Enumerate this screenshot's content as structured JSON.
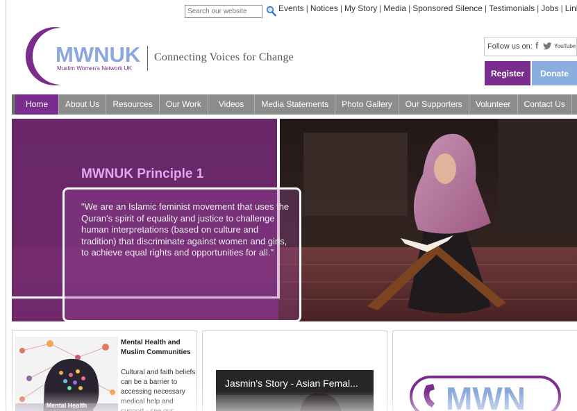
{
  "search": {
    "placeholder": "Search our website"
  },
  "top_links": [
    "Events",
    "Notices",
    "My Story",
    "Media",
    "Sponsored Silence",
    "Testimonials",
    "Jobs",
    "Links"
  ],
  "logo": {
    "wordmark": "MWNUK",
    "subtitle": "Muslim Women's Network UK",
    "tagline": "Connecting Voices  for Change"
  },
  "social": {
    "label": "Follow us on:",
    "icons": [
      "facebook-icon",
      "twitter-icon",
      "youtube-icon"
    ],
    "youtube_text": "YouTube"
  },
  "actions": {
    "register": "Register",
    "donate": "Donate"
  },
  "nav": [
    "Home",
    "About Us",
    "Resources",
    "Our Work",
    "Videos",
    "Media Statements",
    "Photo Gallery",
    "Our Supporters",
    "Volunteer",
    "Contact Us"
  ],
  "hero": {
    "title": "MWNUK Principle 1",
    "quote": "\"We are an Islamic feminist movement that uses the Quran's spirit of equality and justice to challenge human interpretations (based on culture and tradition) that discriminate against women and girls, to achieve equal rights and opportunities for all.\""
  },
  "cards": [
    {
      "title": "Mental Health and Muslim Communities",
      "text": "Cultural and faith beliefs can be a barrier to accessing necessary medical help and support - see our",
      "image_caption": "Mental Health"
    },
    {
      "video_title": "Jasmin's Story - Asian Femal..."
    },
    {
      "logo_text": "MWN"
    }
  ],
  "colors": {
    "brand_purple": "#7b2d8e",
    "donate_blue": "#8aaee0",
    "nav_grey": "#8c8c8c",
    "hero_title": "#e3a6f2",
    "logo_blue": "#8aa8dc"
  }
}
